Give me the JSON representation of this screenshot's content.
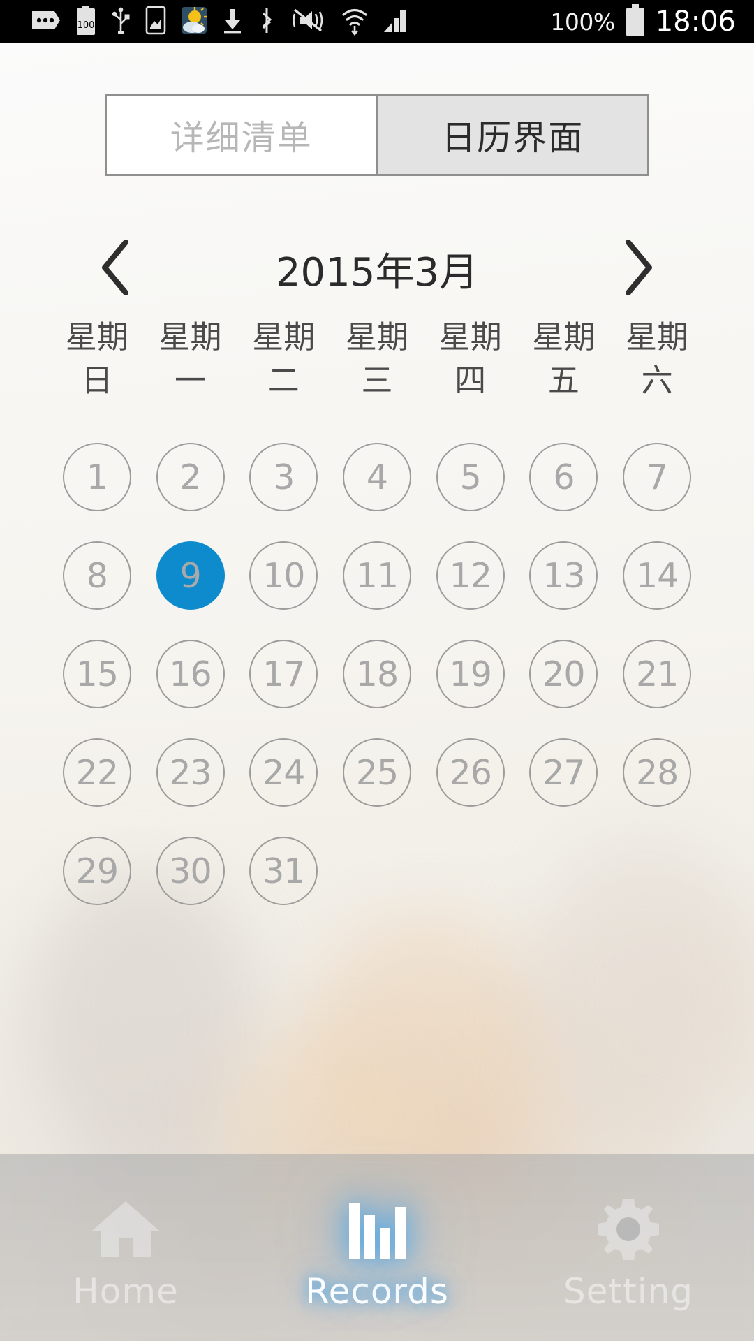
{
  "status_bar": {
    "icons": [
      {
        "name": "messages-icon",
        "glyph": "●●●"
      },
      {
        "name": "battery-saver-100-icon",
        "glyph": "100"
      },
      {
        "name": "usb-icon",
        "glyph": "ψ"
      },
      {
        "name": "screenshot-icon",
        "glyph": "▣"
      },
      {
        "name": "weather-icon",
        "glyph": "☀"
      },
      {
        "name": "download-icon",
        "glyph": "⬇"
      },
      {
        "name": "bluetooth-icon",
        "glyph": "ᛦ"
      },
      {
        "name": "mute-vibrate-icon",
        "glyph": "✗"
      },
      {
        "name": "wifi-icon",
        "glyph": "▲"
      },
      {
        "name": "cellular-signal-icon",
        "glyph": "◥"
      }
    ],
    "battery_percent": "100%",
    "time": "18:06"
  },
  "tabs": {
    "items": [
      {
        "label": "详细清单",
        "active": false
      },
      {
        "label": "日历界面",
        "active": true
      }
    ]
  },
  "month_nav": {
    "prev_icon": "chevron-left-icon",
    "next_icon": "chevron-right-icon",
    "label": "2015年3月",
    "year": "2015",
    "month": "3"
  },
  "weekdays": [
    {
      "top": "星期",
      "bottom": "日"
    },
    {
      "top": "星期",
      "bottom": "一"
    },
    {
      "top": "星期",
      "bottom": "二"
    },
    {
      "top": "星期",
      "bottom": "三"
    },
    {
      "top": "星期",
      "bottom": "四"
    },
    {
      "top": "星期",
      "bottom": "五"
    },
    {
      "top": "星期",
      "bottom": "六"
    }
  ],
  "calendar": {
    "leading_blanks": 0,
    "selected_day": 9,
    "days": [
      "1",
      "2",
      "3",
      "4",
      "5",
      "6",
      "7",
      "8",
      "9",
      "10",
      "11",
      "12",
      "13",
      "14",
      "15",
      "16",
      "17",
      "18",
      "19",
      "20",
      "21",
      "22",
      "23",
      "24",
      "25",
      "26",
      "27",
      "28",
      "29",
      "30",
      "31"
    ]
  },
  "bottom_nav": {
    "items": [
      {
        "label": "Home",
        "icon": "home-icon",
        "active": false
      },
      {
        "label": "Records",
        "icon": "bar-chart-icon",
        "active": true
      },
      {
        "label": "Setting",
        "icon": "gear-icon",
        "active": false
      }
    ]
  },
  "colors": {
    "accent_blue": "#0d8bcd",
    "status_bar_bg": "#000000",
    "tab_active_bg": "#e3e3e3",
    "tab_inactive_bg": "#ffffff",
    "tab_border": "#8f8f8f",
    "day_text": "#a8a8a8",
    "day_border": "#9c9c9c"
  }
}
